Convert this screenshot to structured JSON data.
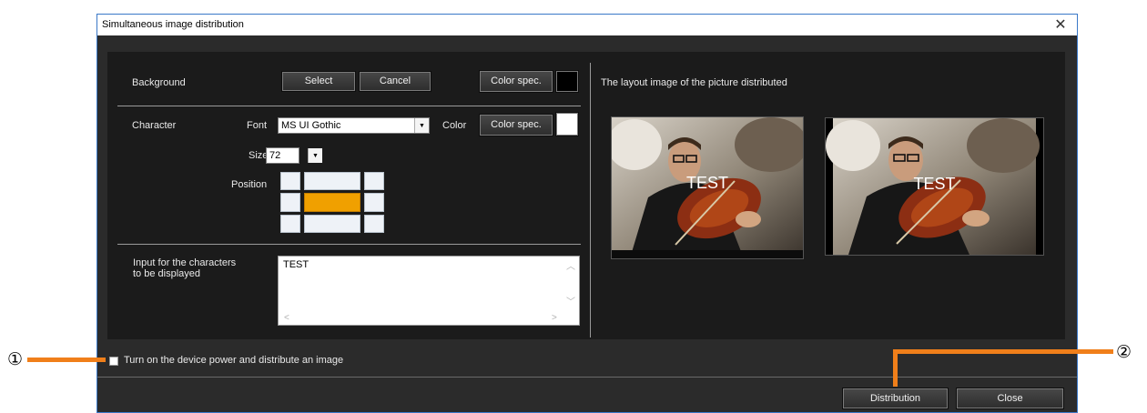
{
  "window": {
    "title": "Simultaneous image distribution",
    "close_glyph": "✕"
  },
  "background": {
    "label": "Background",
    "select_label": "Select",
    "cancel_label": "Cancel",
    "color_spec_label": "Color spec.",
    "color": "#000000"
  },
  "character": {
    "label": "Character",
    "font_label": "Font",
    "font_value": "MS UI Gothic",
    "color_label": "Color",
    "color_spec_label": "Color spec.",
    "color": "#ffffff",
    "size_label": "Size",
    "size_value": "72",
    "position_label": "Position",
    "position_selected": "middle-center"
  },
  "input": {
    "label_line1": "Input for the characters",
    "label_line2": "to be displayed",
    "value": "TEST"
  },
  "layout": {
    "label": "The layout image of the picture distributed",
    "overlay_text": "TEST"
  },
  "options": {
    "device_power_label": "Turn on the device power and distribute an image",
    "device_power_checked": false
  },
  "footer": {
    "distribution_label": "Distribution",
    "close_label": "Close"
  },
  "callouts": {
    "one": "①",
    "two": "②",
    "color": "#f07f1a"
  }
}
